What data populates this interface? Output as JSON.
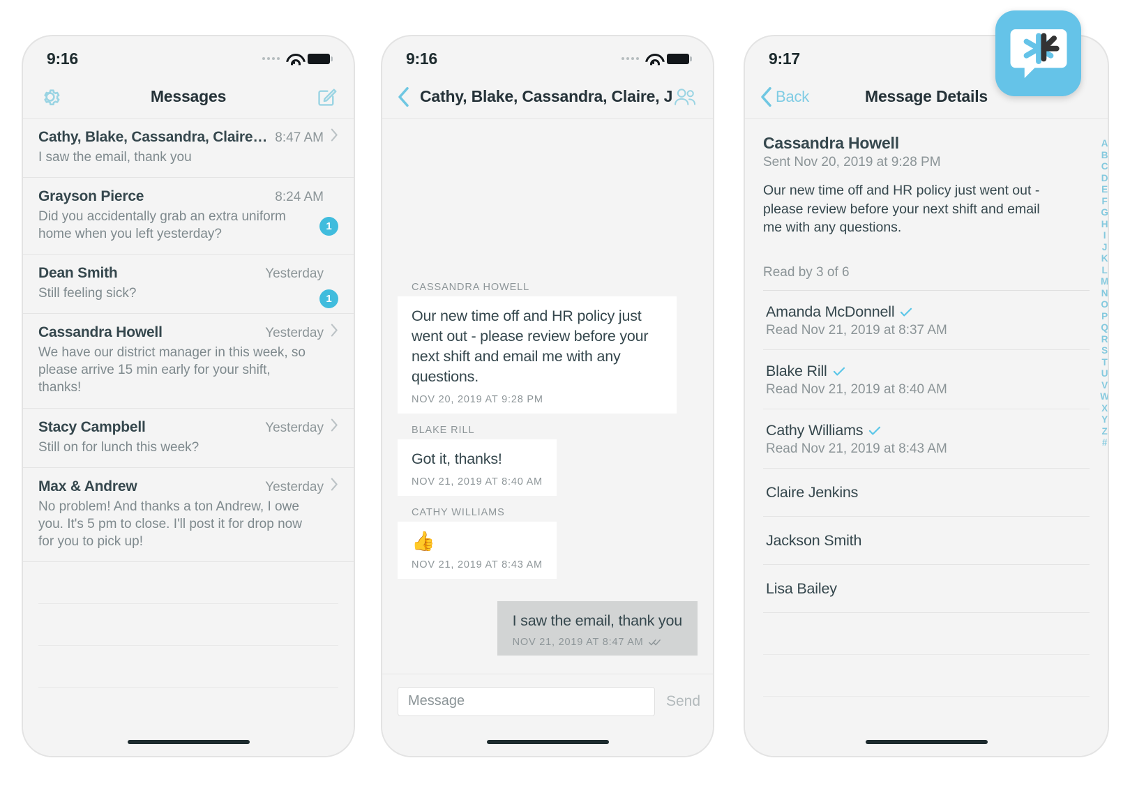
{
  "app": {
    "icon_name": "chat-asterisk-app-icon",
    "icon_bg": "#65c3e8"
  },
  "accent": "#40bcdd",
  "phone1": {
    "status": {
      "time": "9:16",
      "wifi_icon": "wifi-icon",
      "battery_icon": "battery-icon",
      "signal_icon": "signal-dots-icon"
    },
    "nav": {
      "settings_icon": "gear-icon",
      "title": "Messages",
      "compose_icon": "compose-icon"
    },
    "conversations": [
      {
        "name": "Cathy, Blake, Cassandra, Claire, Jacks...",
        "time": "8:47 AM",
        "preview": "I saw the email, thank you",
        "unread": "",
        "chevron": true
      },
      {
        "name": "Grayson Pierce",
        "time": "8:24 AM",
        "preview": "Did you accidentally grab an extra uniform home when you left yesterday?",
        "unread": "1",
        "chevron": false
      },
      {
        "name": "Dean  Smith",
        "time": "Yesterday",
        "preview": "Still feeling sick?",
        "unread": "1",
        "chevron": false
      },
      {
        "name": "Cassandra Howell",
        "time": "Yesterday",
        "preview": "We have our district manager in this week, so please arrive 15 min early for your shift, thanks!",
        "unread": "",
        "chevron": true
      },
      {
        "name": "Stacy Campbell",
        "time": "Yesterday",
        "preview": "Still on for lunch this week?",
        "unread": "",
        "chevron": true
      },
      {
        "name": "Max & Andrew",
        "time": "Yesterday",
        "preview": "No problem! And thanks a ton Andrew, I owe you. It's 5 pm to close. I'll post it for drop now for you to pick up!",
        "unread": "",
        "chevron": true
      }
    ]
  },
  "phone2": {
    "status": {
      "time": "9:16",
      "wifi_icon": "wifi-icon",
      "battery_icon": "battery-icon",
      "signal_icon": "signal-dots-icon"
    },
    "nav": {
      "back_icon": "chevron-left-icon",
      "title": "Cathy, Blake, Cassandra, Claire, Jac...",
      "participants_icon": "people-group-icon"
    },
    "messages": [
      {
        "sender": "CASSANDRA HOWELL",
        "text": "Our new time off and HR policy just went out - please review before your next shift and email me with any questions.",
        "time": "NOV 20, 2019 AT 9:28 PM",
        "emoji": "",
        "outgoing": false
      },
      {
        "sender": "BLAKE RILL",
        "text": "Got it, thanks!",
        "time": "NOV 21, 2019 AT 8:40 AM",
        "emoji": "",
        "outgoing": false
      },
      {
        "sender": "CATHY WILLIAMS",
        "text": "",
        "emoji": "👍",
        "time": "NOV 21, 2019 AT 8:43 AM",
        "outgoing": false
      }
    ],
    "outgoing": {
      "text": "I saw the email, thank you",
      "time": "NOV 21, 2019 AT 8:47 AM",
      "receipt_icon": "double-check-icon"
    },
    "composer": {
      "placeholder": "Message",
      "value": "",
      "send_label": "Send"
    }
  },
  "phone3": {
    "status": {
      "time": "9:17",
      "wifi_icon": "wifi-icon",
      "battery_icon": "battery-icon",
      "signal_icon": "signal-dots-icon"
    },
    "nav": {
      "back_icon": "chevron-left-icon",
      "back_label": "Back",
      "title": "Message Details"
    },
    "message": {
      "sender": "Cassandra Howell",
      "sent": "Sent Nov 20, 2019 at 9:28 PM",
      "body": "Our new time off and HR policy just went out - please review before your next shift and email me with any questions.",
      "read_count": "Read by 3 of 6"
    },
    "readers": [
      {
        "name": "Amanda McDonnell",
        "read": true,
        "when": "Read Nov 21, 2019 at 8:37 AM"
      },
      {
        "name": "Blake Rill",
        "read": true,
        "when": "Read Nov 21, 2019 at 8:40 AM"
      },
      {
        "name": "Cathy Williams",
        "read": true,
        "when": "Read Nov 21, 2019 at 8:43 AM"
      },
      {
        "name": "Claire Jenkins",
        "read": false,
        "when": ""
      },
      {
        "name": "Jackson  Smith",
        "read": false,
        "when": ""
      },
      {
        "name": "Lisa Bailey",
        "read": false,
        "when": ""
      }
    ],
    "alpha_index": [
      "A",
      "B",
      "C",
      "D",
      "E",
      "F",
      "G",
      "H",
      "I",
      "J",
      "K",
      "L",
      "M",
      "N",
      "O",
      "P",
      "Q",
      "R",
      "S",
      "T",
      "U",
      "V",
      "W",
      "X",
      "Y",
      "Z",
      "#"
    ]
  }
}
